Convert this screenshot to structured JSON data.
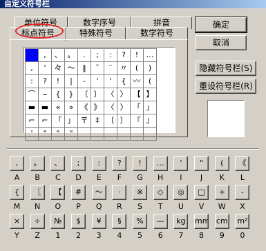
{
  "window": {
    "title": "自定义符号栏"
  },
  "tabs_back": [
    "单位符号",
    "数字序号",
    "拼音"
  ],
  "tabs_front": [
    "标点符号",
    "特殊符号",
    "数学符号"
  ],
  "grid_cells": [
    "",
    ",",
    "、",
    "。",
    ".",
    ";",
    ":",
    "?",
    "!",
    "…",
    ",",
    "'",
    "々",
    "〜",
    "‖",
    "ˇ",
    "¨",
    "〃",
    "(",
    ")",
    ":",
    "?",
    "!",
    "|",
    "-",
    "'",
    "'",
    "{",
    "〰",
    "(",
    "⌒",
    "⌣",
    "{",
    "}",
    "〔",
    "〕",
    "〈",
    "〉",
    "【",
    "】",
    "▬",
    "▬",
    "«",
    "»",
    "《",
    "》",
    "〈",
    "〉",
    "「",
    "」",
    "⌐",
    "⌐",
    "「",
    "」",
    "〒",
    "‡",
    "〔",
    "〕",
    "『",
    "』",
    "'",
    "\"",
    "\"",
    "\"",
    "",
    "",
    "",
    "",
    "",
    ""
  ],
  "buttons": {
    "ok": "确定",
    "cancel": "取消",
    "hide_bar": "隐藏符号栏(S)",
    "reset_bar": "重设符号栏(R)"
  },
  "keys": [
    [
      ",",
      "。",
      "、",
      ";",
      ":",
      "?",
      "!",
      "…",
      "'",
      "\"",
      "(",
      "《"
    ],
    [
      "{",
      "〖",
      "【",
      "#",
      "〜",
      "·",
      "※",
      "◇",
      "◎",
      "□",
      "+",
      "-"
    ],
    [
      "×",
      "÷",
      "№",
      "$",
      "¥",
      "§",
      "%",
      "—",
      "kg",
      "mm",
      "cm",
      "m²"
    ]
  ],
  "key_labels": [
    [
      "A",
      "B",
      "C",
      "D",
      "E",
      "F",
      "G",
      "H",
      "I",
      "J",
      "K",
      "L"
    ],
    [
      "M",
      "N",
      "O",
      "P",
      "Q",
      "R",
      "S",
      "T",
      "U",
      "V",
      "W",
      "X"
    ],
    [
      "Y",
      "Z",
      "1",
      "2",
      "3",
      "4",
      "5",
      "6",
      "7",
      "8",
      "9",
      "0"
    ]
  ],
  "colors": {
    "selection": "#0000ff",
    "highlight": "#e62020"
  }
}
